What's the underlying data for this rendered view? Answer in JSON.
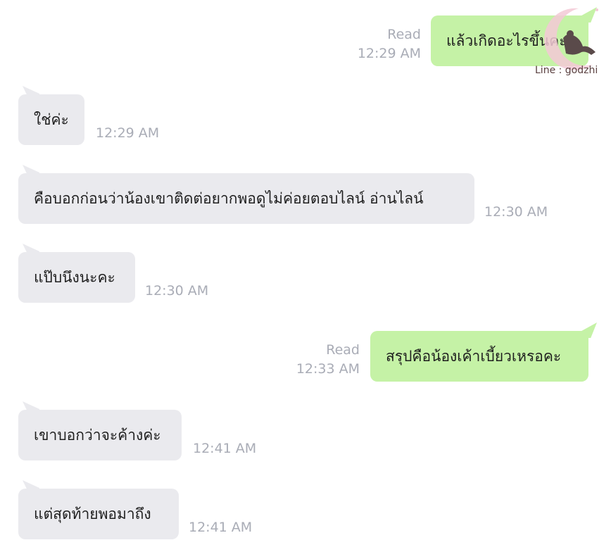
{
  "messages": [
    {
      "direction": "out",
      "text": "แล้วเกิดอะไรขึ้นคะ",
      "read": "Read",
      "time": "12:29 AM"
    },
    {
      "direction": "in",
      "text": "ใช่ค่ะ",
      "time": "12:29 AM"
    },
    {
      "direction": "in",
      "text": "คือบอกก่อนว่าน้องเขาติดต่อยากพอดูไม่ค่อยตอบไลน์ อ่านไลน์",
      "time": "12:30 AM"
    },
    {
      "direction": "in",
      "text": "แป๊บนึงนะคะ",
      "time": "12:30 AM"
    },
    {
      "direction": "out",
      "text": "สรุปคือน้องเค้าเบี้ยวเหรอคะ",
      "read": "Read",
      "time": "12:33 AM"
    },
    {
      "direction": "in",
      "text": "เขาบอกว่าจะค้างค่ะ",
      "time": "12:41 AM"
    },
    {
      "direction": "in",
      "text": "แต่สุดท้ายพอมาถึง",
      "time": "12:41 AM"
    }
  ],
  "watermark": {
    "text": "Line : godzhi",
    "icon": "moon-woman-logo"
  },
  "colors": {
    "incoming": "#eaeaee",
    "outgoing": "#c5f2a6",
    "meta": "#a9acb6"
  }
}
